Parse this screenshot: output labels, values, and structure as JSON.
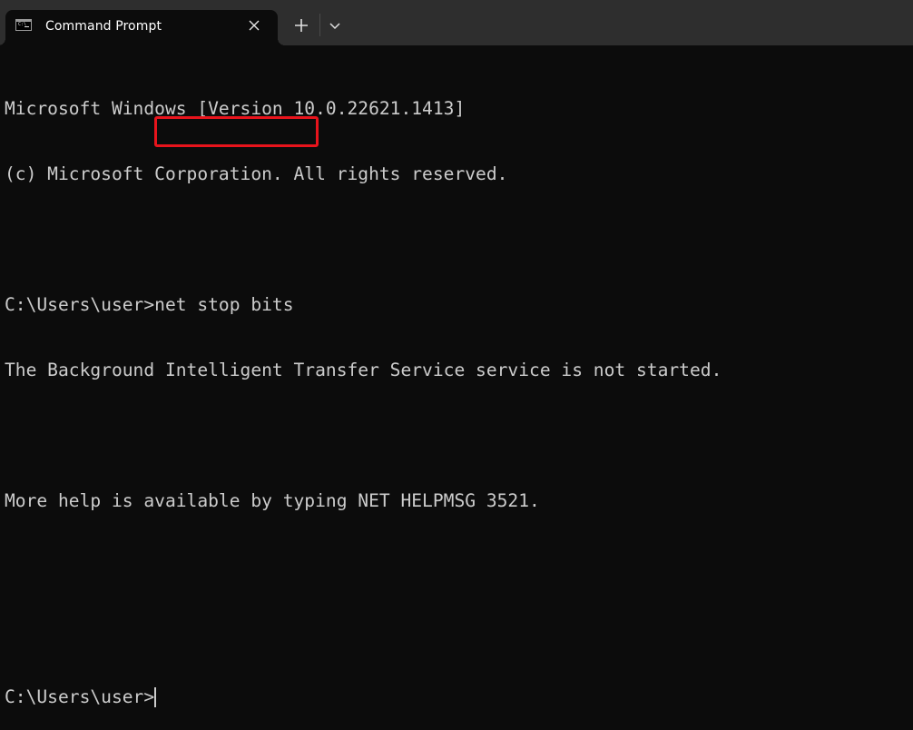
{
  "window": {
    "tab": {
      "title": "Command Prompt",
      "icon": "command-prompt-icon",
      "close_icon": "close-icon"
    },
    "new_tab_icon": "plus-icon",
    "dropdown_icon": "chevron-down-icon"
  },
  "terminal": {
    "lines": [
      "Microsoft Windows [Version 10.0.22621.1413]",
      "(c) Microsoft Corporation. All rights reserved.",
      "",
      "C:\\Users\\user>net stop bits",
      "The Background Intelligent Transfer Service service is not started.",
      "",
      "More help is available by typing NET HELPMSG 3521.",
      "",
      ""
    ],
    "prompt": "C:\\Users\\user>",
    "command": "net stop bits",
    "current_input": ""
  },
  "annotation": {
    "highlighted_text": "net stop bits",
    "color": "#e8141c"
  }
}
